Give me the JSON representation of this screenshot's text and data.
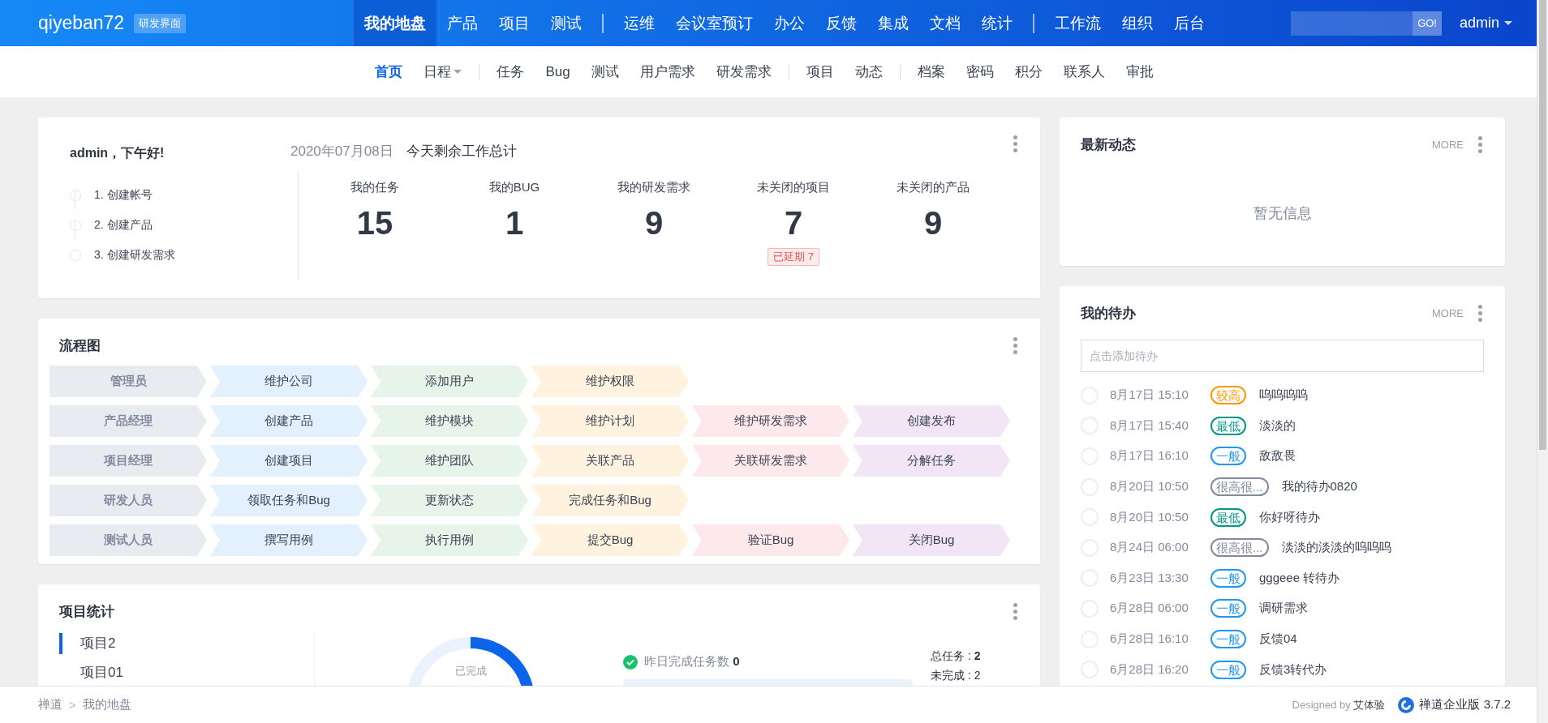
{
  "header": {
    "logo": "qiyeban72",
    "logo_tag": "研发界面",
    "nav_groups": [
      [
        {
          "label": "我的地盘",
          "selected": true
        },
        {
          "label": "产品",
          "selected": false
        },
        {
          "label": "项目",
          "selected": false
        },
        {
          "label": "测试",
          "selected": false
        }
      ],
      [
        {
          "label": "运维",
          "selected": false
        },
        {
          "label": "会议室预订",
          "selected": false
        },
        {
          "label": "办公",
          "selected": false
        },
        {
          "label": "反馈",
          "selected": false
        },
        {
          "label": "集成",
          "selected": false
        },
        {
          "label": "文档",
          "selected": false
        },
        {
          "label": "统计",
          "selected": false
        }
      ],
      [
        {
          "label": "工作流",
          "selected": false
        },
        {
          "label": "组织",
          "selected": false
        },
        {
          "label": "后台",
          "selected": false
        }
      ]
    ],
    "search": {
      "button": "GO!"
    },
    "user": {
      "name": "admin"
    }
  },
  "subnav": {
    "groups": [
      [
        {
          "label": "首页",
          "selected": true,
          "dropdown": false
        },
        {
          "label": "日程",
          "selected": false,
          "dropdown": true
        }
      ],
      [
        {
          "label": "任务",
          "selected": false,
          "dropdown": false
        },
        {
          "label": "Bug",
          "selected": false,
          "dropdown": false
        },
        {
          "label": "测试",
          "selected": false,
          "dropdown": false
        },
        {
          "label": "用户需求",
          "selected": false,
          "dropdown": false
        },
        {
          "label": "研发需求",
          "selected": false,
          "dropdown": false
        }
      ],
      [
        {
          "label": "项目",
          "selected": false,
          "dropdown": false
        },
        {
          "label": "动态",
          "selected": false,
          "dropdown": false
        }
      ],
      [
        {
          "label": "档案",
          "selected": false,
          "dropdown": false
        },
        {
          "label": "密码",
          "selected": false,
          "dropdown": false
        },
        {
          "label": "积分",
          "selected": false,
          "dropdown": false
        },
        {
          "label": "联系人",
          "selected": false,
          "dropdown": false
        },
        {
          "label": "审批",
          "selected": false,
          "dropdown": false
        }
      ]
    ]
  },
  "welcome": {
    "greeting": "admin，下午好!",
    "steps": [
      "1. 创建帐号",
      "2. 创建产品",
      "3. 创建研发需求"
    ],
    "date": "2020年07月08日",
    "summary_title": "今天剩余工作总计",
    "stats": [
      {
        "label": "我的任务",
        "value": "15"
      },
      {
        "label": "我的BUG",
        "value": "1"
      },
      {
        "label": "我的研发需求",
        "value": "9"
      },
      {
        "label": "未关闭的项目",
        "value": "7",
        "badge": "已延期 7"
      },
      {
        "label": "未关闭的产品",
        "value": "9"
      }
    ]
  },
  "flow": {
    "title": "流程图",
    "rows": [
      {
        "role": "管理员",
        "steps": [
          "维护公司",
          "添加用户",
          "维护权限"
        ]
      },
      {
        "role": "产品经理",
        "steps": [
          "创建产品",
          "维护模块",
          "维护计划",
          "维护研发需求",
          "创建发布"
        ]
      },
      {
        "role": "项目经理",
        "steps": [
          "创建项目",
          "维护团队",
          "关联产品",
          "关联研发需求",
          "分解任务"
        ]
      },
      {
        "role": "研发人员",
        "steps": [
          "领取任务和Bug",
          "更新状态",
          "完成任务和Bug"
        ]
      },
      {
        "role": "测试人员",
        "steps": [
          "撰写用例",
          "执行用例",
          "提交Bug",
          "验证Bug",
          "关闭Bug"
        ]
      }
    ]
  },
  "project_stats": {
    "title": "项目统计",
    "projects": [
      {
        "name": "项目2",
        "selected": true
      },
      {
        "name": "项目01",
        "selected": false
      }
    ],
    "donut": {
      "label": "已完成"
    },
    "yesterday": {
      "label": "昨日完成任务数 **0**",
      "level": 0
    },
    "totals": [
      "总任务 : **2**",
      "未完成 : 2"
    ]
  },
  "news": {
    "title": "最新动态",
    "more": "MORE",
    "empty": "暂无信息"
  },
  "todos": {
    "title": "我的待办",
    "more": "MORE",
    "input": {
      "placeholder": "点击添加待办"
    },
    "items": [
      {
        "checked": false,
        "time": "8月17日 15:10",
        "priority": "较高",
        "color": "#ff9800",
        "title": "呜呜呜呜"
      },
      {
        "checked": false,
        "time": "8月17日 15:40",
        "priority": "最低",
        "color": "#009688",
        "title": "淡淡的"
      },
      {
        "checked": false,
        "time": "8月17日 16:10",
        "priority": "一般",
        "color": "#2196f3",
        "title": "敌敌畏"
      },
      {
        "checked": false,
        "time": "8月20日 10:50",
        "priority": "很高很...",
        "color": "#838a9d",
        "title": "我的待办0820"
      },
      {
        "checked": false,
        "time": "8月20日 10:50",
        "priority": "最低",
        "color": "#009688",
        "title": "你好呀待办"
      },
      {
        "checked": false,
        "time": "8月24日 06:00",
        "priority": "很高很...",
        "color": "#838a9d",
        "title": "淡淡的淡淡的呜呜呜"
      },
      {
        "checked": false,
        "time": "6月23日 13:30",
        "priority": "一般",
        "color": "#2196f3",
        "title": "gggeee 转待办"
      },
      {
        "checked": false,
        "time": "6月28日 06:00",
        "priority": "一般",
        "color": "#2196f3",
        "title": "调研需求"
      },
      {
        "checked": false,
        "time": "6月28日 16:10",
        "priority": "一般",
        "color": "#2196f3",
        "title": "反馈04"
      },
      {
        "checked": false,
        "time": "6月28日 16:20",
        "priority": "一般",
        "color": "#2196f3",
        "title": "反馈3转代办"
      }
    ]
  },
  "footer": {
    "breadcrumb": [
      "禅道",
      "我的地盘"
    ],
    "separator": ">",
    "designed_by": "Designed by **艾体验**",
    "version": "禅道企业版 3.7.2"
  }
}
